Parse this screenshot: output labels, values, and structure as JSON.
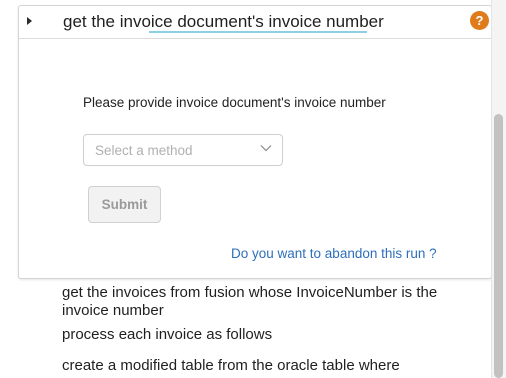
{
  "card": {
    "title": "get the invoice document's invoice number",
    "help_symbol": "?",
    "prompt": "Please provide invoice document's invoice number",
    "method_select": {
      "placeholder": "Select a method",
      "selected": ""
    },
    "submit_label": "Submit",
    "abandon_link": "Do you want to abandon this run ?"
  },
  "steps": [
    {
      "text": "get the invoices from fusion whose InvoiceNumber is the invoice number"
    },
    {
      "text": "process each invoice as follows"
    },
    {
      "text": "create a modified table from the oracle table where"
    }
  ],
  "colors": {
    "help_badge": "#e07b1c",
    "link": "#2e6fbb",
    "title_underline": "#8ecfe4"
  },
  "icons": {
    "toggle": "caret-right-icon",
    "help": "help-icon",
    "dropdown": "chevron-down-icon"
  }
}
